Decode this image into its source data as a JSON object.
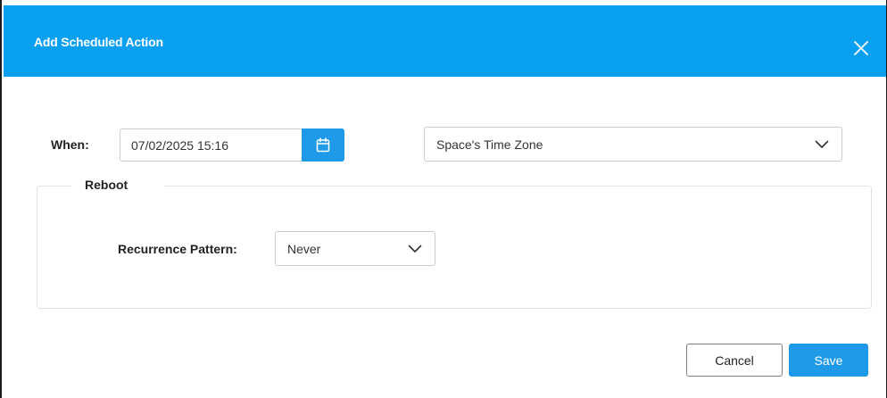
{
  "dialog": {
    "title": "Add Scheduled Action",
    "close_icon": "close-icon"
  },
  "when": {
    "label": "When:",
    "datetime_value": "07/02/2025 15:16",
    "calendar_icon": "calendar-icon",
    "timezone_selected": "Space's Time Zone"
  },
  "action": {
    "legend": "Reboot",
    "recurrence_label": "Recurrence Pattern:",
    "recurrence_selected": "Never"
  },
  "footer": {
    "cancel_label": "Cancel",
    "save_label": "Save"
  },
  "colors": {
    "header_bg": "#0aa0f2",
    "primary_button": "#1e9ae8"
  }
}
